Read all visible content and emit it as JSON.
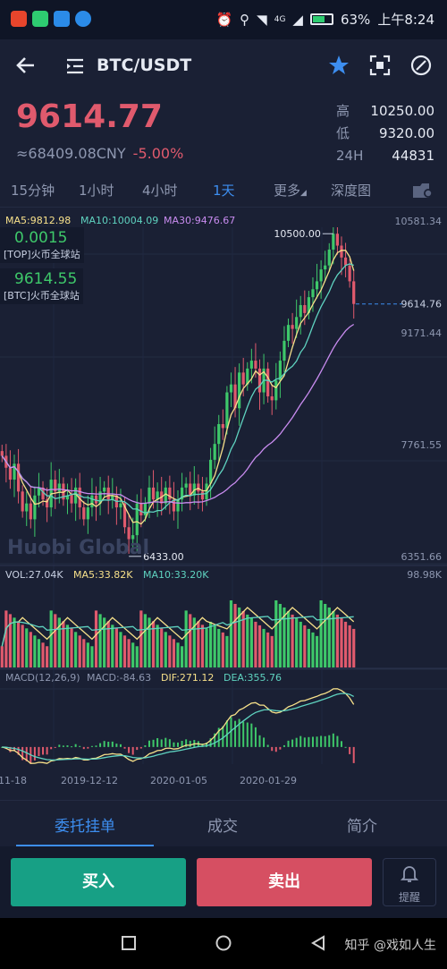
{
  "status": {
    "battery": "63%",
    "time": "上午8:24",
    "network": "4G",
    "battery_level": 0.63
  },
  "header": {
    "pair": "BTC/USDT"
  },
  "ticker": {
    "price": "9614.77",
    "cny": "≈68409.08CNY",
    "change": "-5.00%",
    "high_label": "高",
    "high": "10250.00",
    "low_label": "低",
    "low": "9320.00",
    "vol_label": "24H",
    "vol": "44831"
  },
  "tabs": [
    "15分钟",
    "1小时",
    "4小时",
    "1天",
    "更多",
    "深度图"
  ],
  "chart_legend": {
    "ma5": "MA5:9812.98",
    "ma10": "MA10:10004.09",
    "ma30": "MA30:9476.67"
  },
  "info_boxes": [
    {
      "value": "0.0015",
      "label": "[TOP]火币全球站"
    },
    {
      "value": "9614.55",
      "label": "[BTC]火币全球站"
    }
  ],
  "watermark": "Huobi Global",
  "y_ticks": [
    "10581.34",
    "9614.76",
    "9171.44",
    "7761.55",
    "6351.66"
  ],
  "annotations": {
    "high": "10500.00",
    "low": "6433.00"
  },
  "volume_legend": {
    "vol": "VOL:27.04K",
    "ma5": "MA5:33.82K",
    "ma10": "MA10:33.20K",
    "max": "98.98K"
  },
  "macd_legend": {
    "title": "MACD(12,26,9)",
    "macd": "MACD:-84.63",
    "dif": "DIF:271.12",
    "dea": "DEA:355.76"
  },
  "x_ticks": [
    "11-18",
    "2019-12-12",
    "2020-01-05",
    "2020-01-29"
  ],
  "bottom_tabs": [
    "委托挂单",
    "成交",
    "简介"
  ],
  "actions": {
    "buy": "买入",
    "sell": "卖出",
    "alert": "提醒"
  },
  "credit": "知乎 @戏如人生",
  "colors": {
    "up": "#3ec86a",
    "down": "#e05a6d",
    "accent": "#3d8ef0",
    "ma5": "#f7e08a",
    "ma10": "#5fd3c0",
    "ma30": "#c98cf0"
  },
  "chart_data": {
    "type": "candlestick",
    "title": "BTC/USDT",
    "period": "1天",
    "y_ticks": [
      10581.34,
      9614.76,
      9171.44,
      7761.55,
      6351.66
    ],
    "ylim": [
      6351.66,
      10581.34
    ],
    "closes": [
      7700,
      7550,
      7400,
      7600,
      7250,
      7000,
      7100,
      6900,
      7200,
      7300,
      7150,
      7050,
      7400,
      7250,
      7350,
      7150,
      7200,
      7100,
      7300,
      7050,
      6900,
      7050,
      7200,
      7100,
      7250,
      7300,
      7150,
      7200,
      7050,
      7100,
      6800,
      6650,
      6700,
      7100,
      6950,
      7100,
      7300,
      7150,
      7250,
      7100,
      7300,
      7150,
      7000,
      7150,
      7300,
      7350,
      7200,
      7350,
      7250,
      7150,
      7350,
      7650,
      7850,
      8100,
      8050,
      8500,
      8600,
      8300,
      8750,
      8600,
      8800,
      8900,
      8800,
      8500,
      8800,
      8450,
      8400,
      8650,
      8900,
      9150,
      9350,
      9300,
      9450,
      9600,
      9500,
      9700,
      9800,
      9900,
      10050,
      10100,
      10300,
      10500,
      10350,
      10200,
      10100,
      9900,
      9614.77
    ],
    "volume_ymax": 98980
  }
}
